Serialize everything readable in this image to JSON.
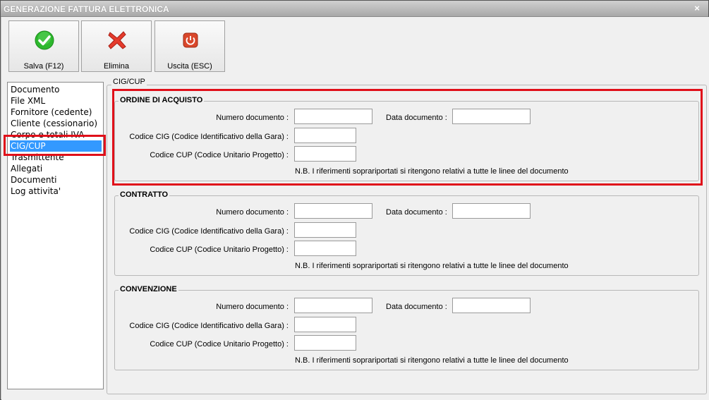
{
  "window": {
    "title": "GENERAZIONE FATTURA ELETTRONICA",
    "close_glyph": "×"
  },
  "toolbar": {
    "save_label": "Salva (F12)",
    "delete_label": "Elimina",
    "exit_label": "Uscita (ESC)"
  },
  "nav": {
    "items": [
      {
        "label": "Documento"
      },
      {
        "label": "File XML"
      },
      {
        "label": "Fornitore (cedente)"
      },
      {
        "label": "Cliente (cessionario)"
      },
      {
        "label": "Corpo e totali IVA"
      },
      {
        "label": "CIG/CUP"
      },
      {
        "label": "Trasmittente"
      },
      {
        "label": "Allegati"
      },
      {
        "label": "Documenti"
      },
      {
        "label": "Log attivita'"
      }
    ],
    "selected": "CIG/CUP"
  },
  "panel": {
    "title": "CIG/CUP"
  },
  "groups": [
    {
      "title": "ORDINE DI ACQUISTO",
      "num_doc_label": "Numero documento :",
      "data_doc_label": "Data documento :",
      "cig_label": "Codice CIG (Codice Identificativo della Gara) :",
      "cup_label": "Codice CUP (Codice Unitario Progetto) :",
      "note": "N.B. I riferimenti soprariportati si ritengono relativi a tutte le linee del documento",
      "num_doc_value": "",
      "data_doc_value": "",
      "cig_value": "",
      "cup_value": ""
    },
    {
      "title": "CONTRATTO",
      "num_doc_label": "Numero documento :",
      "data_doc_label": "Data documento :",
      "cig_label": "Codice CIG (Codice Identificativo della Gara) :",
      "cup_label": "Codice CUP (Codice Unitario Progetto) :",
      "note": "N.B. I riferimenti soprariportati si ritengono relativi a tutte le linee del documento",
      "num_doc_value": "",
      "data_doc_value": "",
      "cig_value": "",
      "cup_value": ""
    },
    {
      "title": "CONVENZIONE",
      "num_doc_label": "Numero documento :",
      "data_doc_label": "Data documento :",
      "cig_label": "Codice CIG (Codice Identificativo della Gara) :",
      "cup_label": "Codice CUP (Codice Unitario Progetto) :",
      "note": "N.B. I riferimenti soprariportati si ritengono relativi a tutte le linee del documento",
      "num_doc_value": "",
      "data_doc_value": "",
      "cig_value": "",
      "cup_value": ""
    }
  ],
  "icons": {
    "save": "checkmark-icon",
    "delete": "red-x-icon",
    "exit": "power-icon"
  },
  "colors": {
    "highlight": "#e0101a",
    "selection": "#3399ff",
    "save_icon": "#2db82d",
    "delete_icon": "#e53b2c",
    "exit_icon": "#d9472b"
  }
}
